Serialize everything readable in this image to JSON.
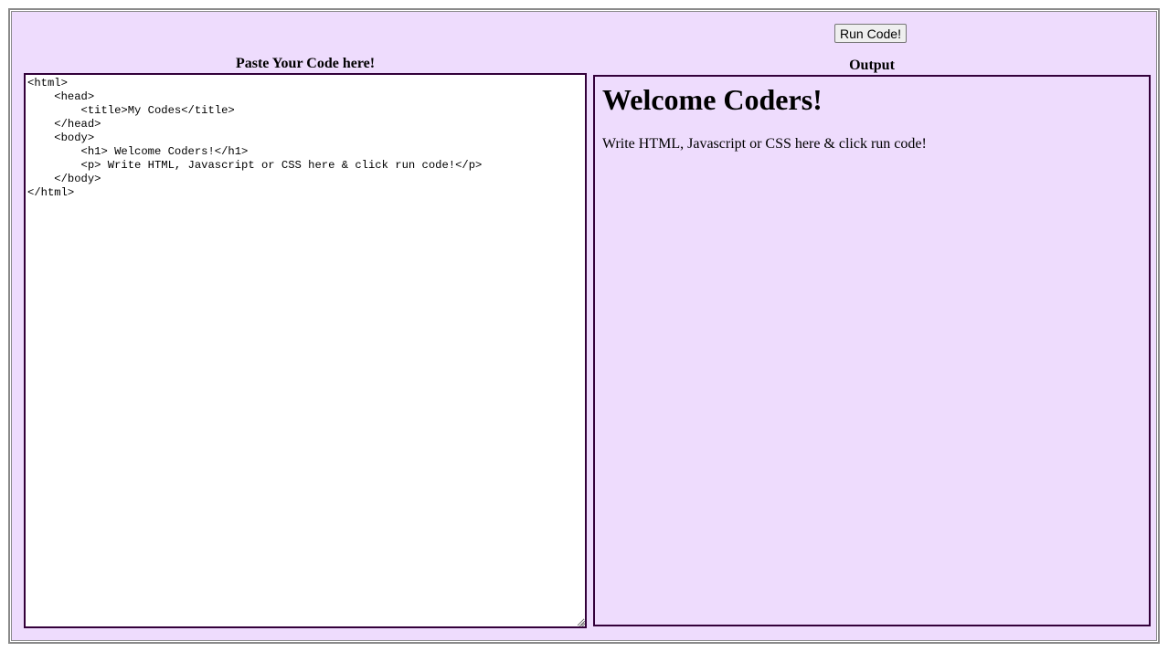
{
  "toolbar": {
    "run_label": "Run Code!"
  },
  "editor": {
    "heading": "Paste Your Code here!",
    "code": "<html>\n    <head>\n        <title>My Codes</title>\n    </head>\n    <body>\n        <h1> Welcome Coders!</h1>\n        <p> Write HTML, Javascript or CSS here & click run code!</p>\n    </body>\n</html>"
  },
  "output": {
    "heading": "Output",
    "h1": "Welcome Coders!",
    "p": "Write HTML, Javascript or CSS here & click run code!"
  },
  "colors": {
    "background": "#eedcfd",
    "border": "#33003a"
  }
}
